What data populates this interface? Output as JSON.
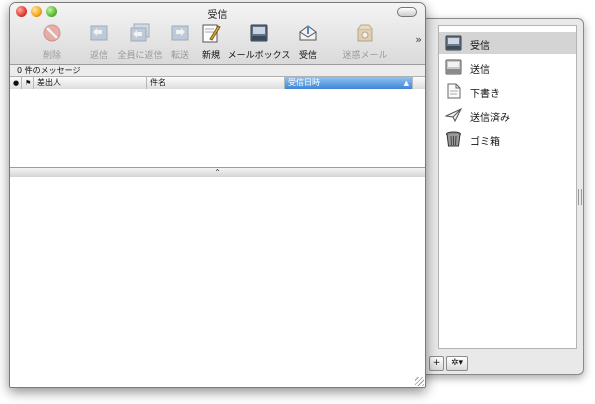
{
  "window": {
    "title": "受信"
  },
  "toolbar": {
    "buttons": [
      {
        "label": "削除",
        "icon": "delete-icon",
        "enabled": false
      },
      {
        "label": "返信",
        "icon": "reply-icon",
        "enabled": false
      },
      {
        "label": "全員に返信",
        "icon": "reply-all-icon",
        "enabled": false
      },
      {
        "label": "転送",
        "icon": "forward-icon",
        "enabled": false
      },
      {
        "label": "新規",
        "icon": "compose-icon",
        "enabled": true
      },
      {
        "label": "メールボックス",
        "icon": "mailbox-icon",
        "enabled": true
      },
      {
        "label": "受信",
        "icon": "get-mail-icon",
        "enabled": true
      },
      {
        "label": "迷惑メール",
        "icon": "junk-icon",
        "enabled": false
      }
    ],
    "more": "»"
  },
  "status": {
    "message_count": "0 件のメッセージ"
  },
  "columns": {
    "read": "●",
    "flag": "⚑",
    "from": "差出人",
    "subject": "件名",
    "received": "受信日時",
    "sort_indicator": "▲"
  },
  "splitter": {
    "glyph": "⌃"
  },
  "drawer": {
    "mailboxes": [
      {
        "label": "受信",
        "icon": "inbox-icon",
        "selected": true
      },
      {
        "label": "送信",
        "icon": "outbox-icon",
        "selected": false
      },
      {
        "label": "下書き",
        "icon": "drafts-icon",
        "selected": false
      },
      {
        "label": "送信済み",
        "icon": "sent-icon",
        "selected": false
      },
      {
        "label": "ゴミ箱",
        "icon": "trash-icon",
        "selected": false
      }
    ],
    "add_label": "+",
    "action_label": "✲▾"
  },
  "colors": {
    "selection": "#d4d4d4",
    "sorted_header": "#3f86d6"
  }
}
